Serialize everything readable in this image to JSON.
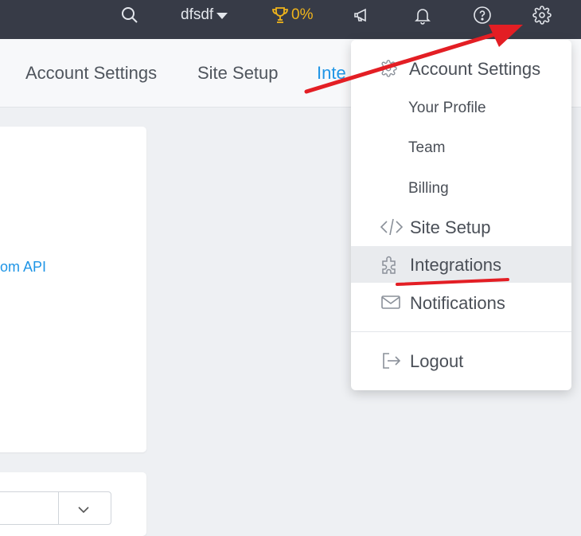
{
  "topbar": {
    "username": "dfsdf",
    "progress_value": "0%",
    "icons": [
      "search-icon",
      "trophy-icon",
      "megaphone-icon",
      "bell-icon",
      "help-icon",
      "gear-icon"
    ],
    "accent_color": "#f0b41b",
    "background_color": "#373b47"
  },
  "tabs": [
    {
      "label": "Account Settings",
      "active": false
    },
    {
      "label": "Site Setup",
      "active": false
    },
    {
      "label": "Inte",
      "active": true
    }
  ],
  "content": {
    "link_text": "om API"
  },
  "dropdown": {
    "items": [
      {
        "label": "Account Settings",
        "icon": "gear-icon",
        "type": "header"
      },
      {
        "label": "Your Profile",
        "type": "subitem"
      },
      {
        "label": "Team",
        "type": "subitem"
      },
      {
        "label": "Billing",
        "type": "subitem"
      },
      {
        "label": "Site Setup",
        "icon": "code-icon",
        "type": "item"
      },
      {
        "label": "Integrations",
        "icon": "puzzle-icon",
        "type": "item",
        "highlighted": true
      },
      {
        "label": "Notifications",
        "icon": "envelope-icon",
        "type": "item"
      },
      {
        "label": "Logout",
        "icon": "logout-icon",
        "type": "item"
      }
    ]
  },
  "annotations": {
    "arrow_color": "#e31e24",
    "underline_color": "#e31e24"
  }
}
